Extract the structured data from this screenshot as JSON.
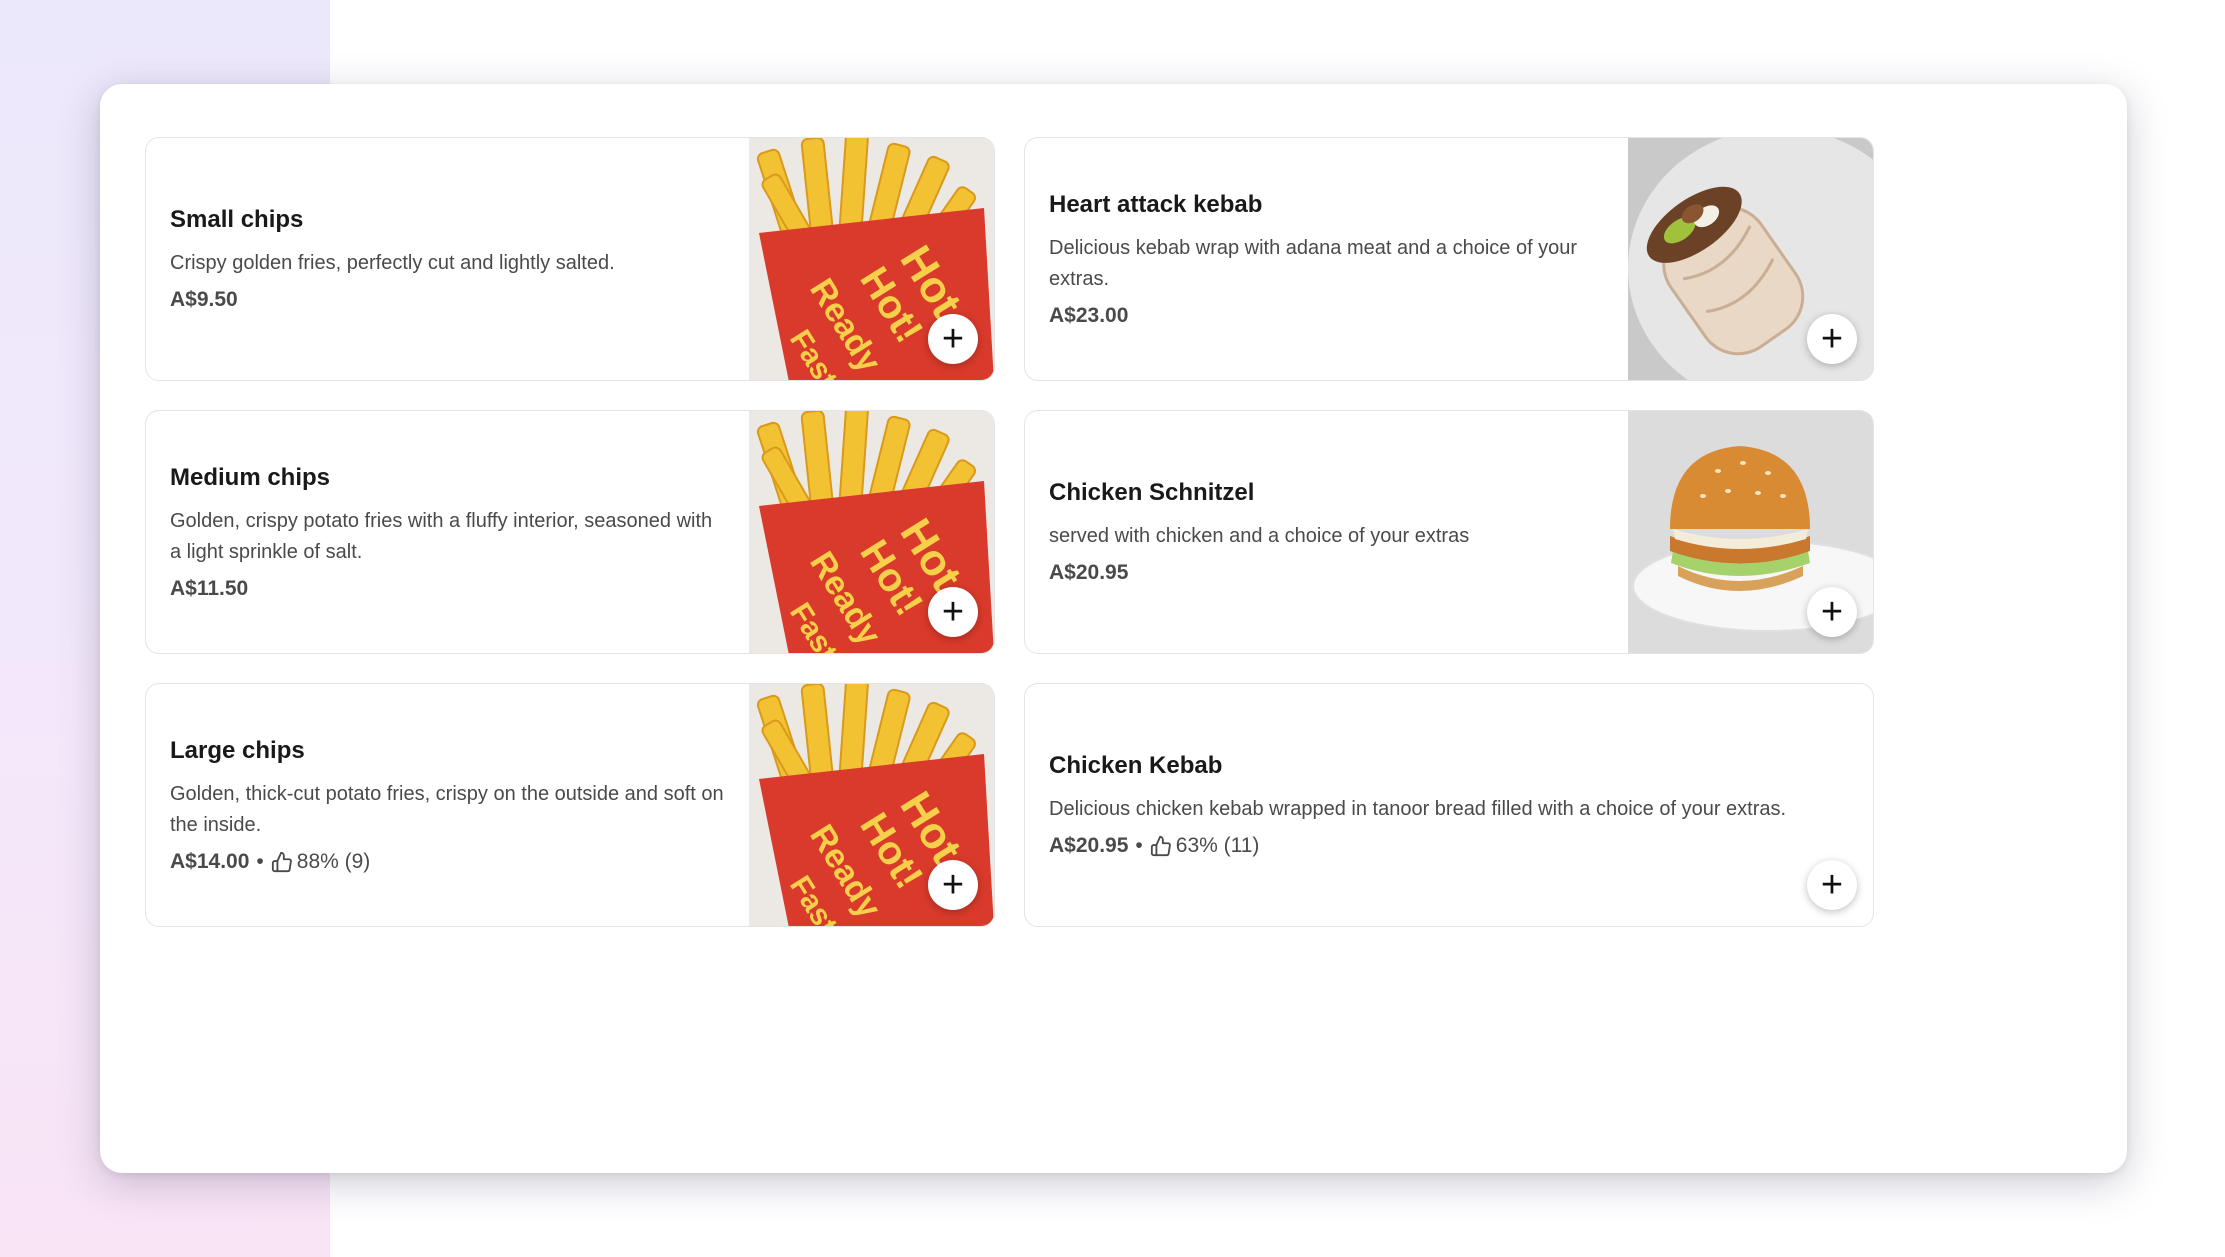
{
  "menu": {
    "items": [
      {
        "name": "Small chips",
        "description": "Crispy golden fries, perfectly cut and lightly salted.",
        "price": "A$9.50",
        "image": "fries",
        "add_label": "+"
      },
      {
        "name": "Heart attack kebab",
        "description": "Delicious kebab wrap with adana meat and a choice of your extras.",
        "price": "A$23.00",
        "image": "wrap",
        "add_label": "+"
      },
      {
        "name": "Medium chips",
        "description": "Golden, crispy potato fries with a fluffy interior, seasoned with a light sprinkle of salt.",
        "price": "A$11.50",
        "image": "fries",
        "add_label": "+"
      },
      {
        "name": "Chicken Schnitzel",
        "description": "served with chicken and a choice of your extras",
        "price": "A$20.95",
        "image": "burger",
        "add_label": "+"
      },
      {
        "name": "Large chips",
        "description": "Golden, thick-cut potato fries, crispy on the outside and soft on the inside.",
        "price": "A$14.00",
        "rating": "88% (9)",
        "separator": "•",
        "image": "fries",
        "add_label": "+"
      },
      {
        "name": "Chicken Kebab",
        "description": "Delicious chicken kebab wrapped in tanoor bread filled with a choice of your extras.",
        "price": "A$20.95",
        "rating": "63% (11)",
        "separator": "•",
        "add_label": "+"
      }
    ]
  },
  "colors": {
    "accent_red": "#d93a2b",
    "fries_yellow": "#f2c232",
    "text_dark": "#191919",
    "text_muted": "#4a4a4a"
  }
}
